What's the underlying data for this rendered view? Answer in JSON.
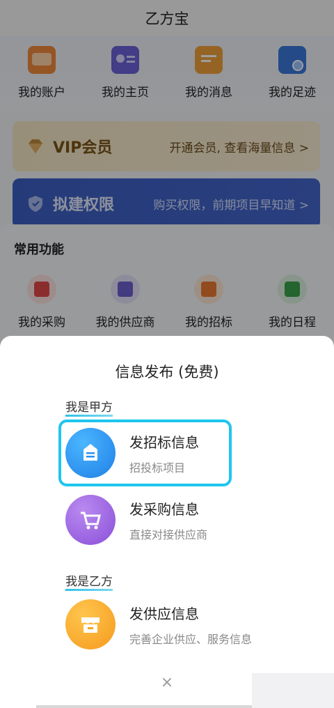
{
  "app": {
    "title": "乙方宝"
  },
  "top_menu": [
    {
      "label": "我的账户",
      "icon": "wallet-icon",
      "color": "#f08a3c"
    },
    {
      "label": "我的主页",
      "icon": "id-card-icon",
      "color": "#6b63d9"
    },
    {
      "label": "我的消息",
      "icon": "message-icon",
      "color": "#f0a23c"
    },
    {
      "label": "我的足迹",
      "icon": "footprint-icon",
      "color": "#3b78db"
    }
  ],
  "vip_banner": {
    "title": "VIP会员",
    "subtitle": "开通会员, 查看海量信息 >",
    "icon": "diamond-icon"
  },
  "permission_banner": {
    "title": "拟建权限",
    "subtitle": "购买权限，前期项目早知道 >",
    "icon": "shield-icon"
  },
  "common_functions": {
    "title": "常用功能",
    "items": [
      {
        "label": "我的采购",
        "icon": "shopping-bag-icon",
        "color": "#e24a4a"
      },
      {
        "label": "我的供应商",
        "icon": "store-icon",
        "color": "#6d5fcf"
      },
      {
        "label": "我的招标",
        "icon": "bid-icon",
        "color": "#ea7a33"
      },
      {
        "label": "我的日程",
        "icon": "calendar-icon",
        "color": "#3aa24b"
      }
    ]
  },
  "sheet": {
    "title": "信息发布 (免费)",
    "party_a_label": "我是甲方",
    "party_b_label": "我是乙方",
    "options": [
      {
        "name": "发招标信息",
        "desc": "招投标项目",
        "icon": "bid-info-icon",
        "color": "#2a8ff0"
      },
      {
        "name": "发采购信息",
        "desc": "直接对接供应商",
        "icon": "cart-icon",
        "color": "#9a5ee0"
      },
      {
        "name": "发供应信息",
        "desc": "完善企业供应、服务信息",
        "icon": "store-icon",
        "color": "#f5a623"
      }
    ],
    "close_glyph": "×"
  }
}
